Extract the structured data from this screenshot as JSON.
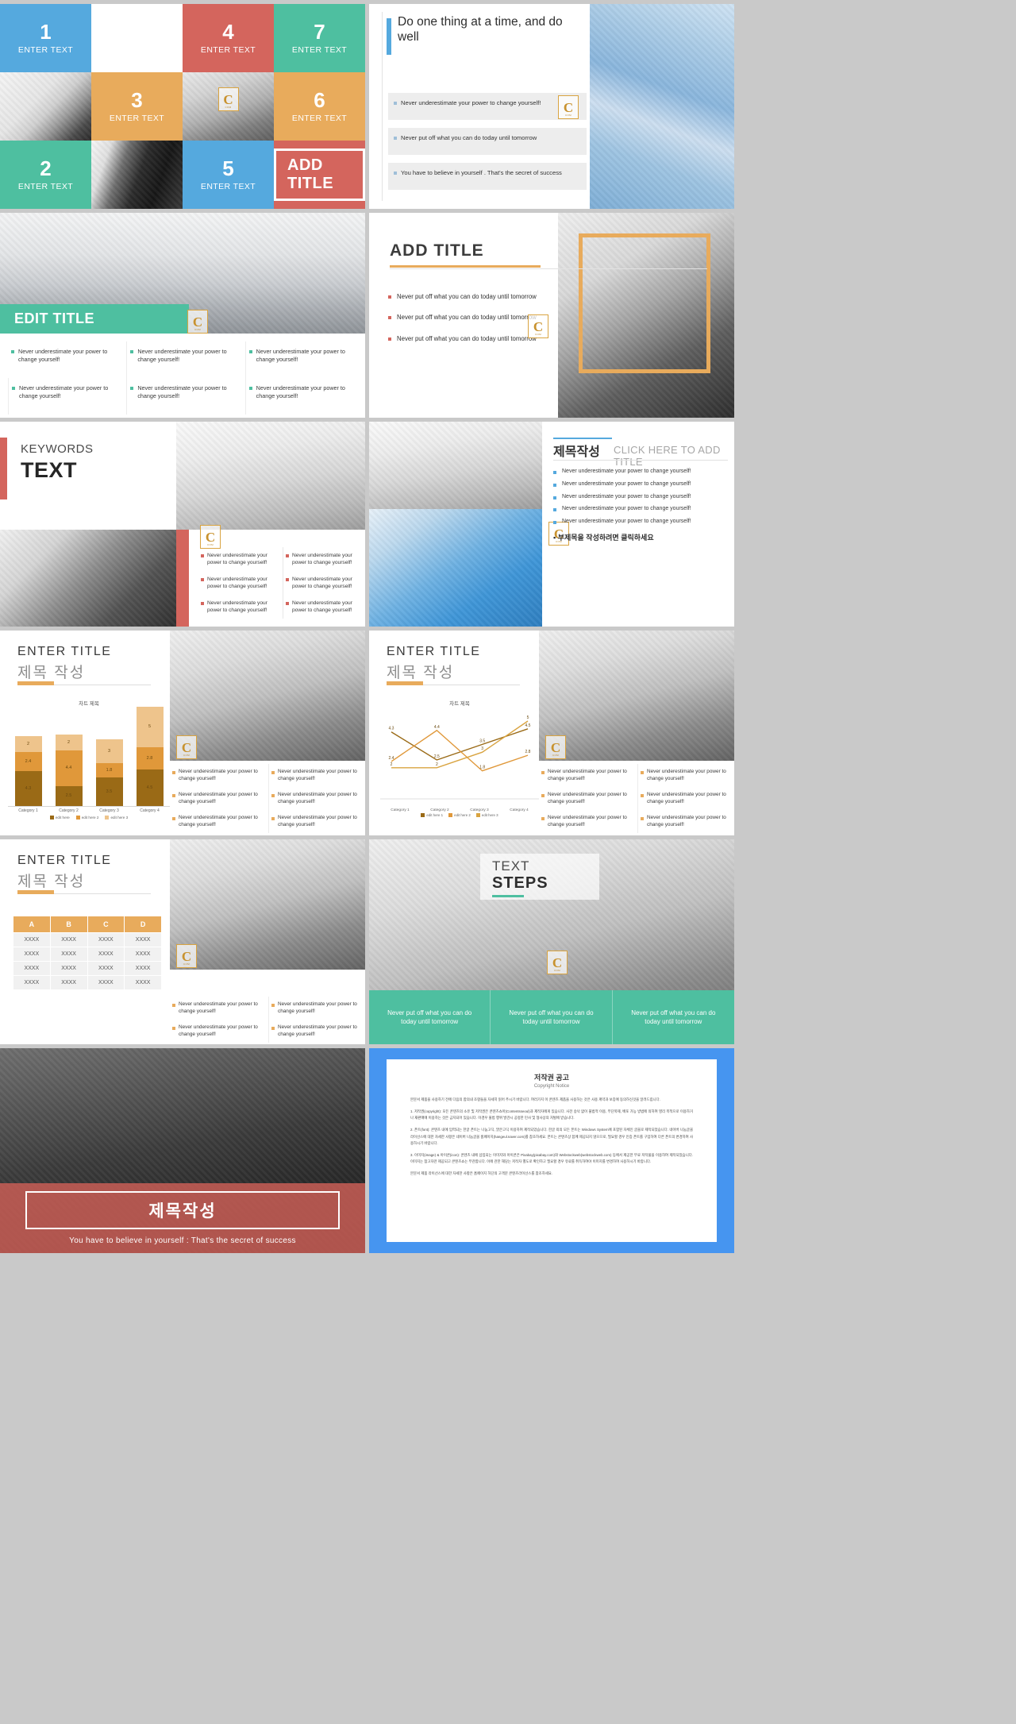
{
  "brand": {
    "logo_letter": "C",
    "logo_sub": "COM",
    "colors": {
      "blue": "#55a9de",
      "red": "#d4655d",
      "teal": "#4ebfa0",
      "orange": "#e8ab5c",
      "gold": "#9a6a16",
      "page_bg": "#c9c9c9"
    }
  },
  "slide1": {
    "tiles": [
      {
        "num": "1",
        "caption": "ENTER TEXT",
        "kind": "color",
        "color": "blue"
      },
      {
        "num": "",
        "caption": "",
        "kind": "blank",
        "color": "white"
      },
      {
        "num": "4",
        "caption": "ENTER TEXT",
        "kind": "color",
        "color": "red"
      },
      {
        "num": "",
        "caption": "",
        "kind": "photo",
        "photo": "ph-suit"
      },
      {
        "num": "7",
        "caption": "ENTER TEXT",
        "kind": "color",
        "color": "teal"
      },
      {
        "num": "",
        "caption": "",
        "kind": "photo",
        "photo": "ph-calc"
      },
      {
        "num": "3",
        "caption": "ENTER TEXT",
        "kind": "color",
        "color": "orange"
      },
      {
        "num": "",
        "caption": "",
        "kind": "photo",
        "photo": "ph-meet"
      },
      {
        "num": "6",
        "caption": "ENTER TEXT",
        "kind": "color",
        "color": "orange"
      },
      {
        "num": "",
        "caption": "",
        "kind": "blank",
        "color": "white"
      },
      {
        "num": "2",
        "caption": "ENTER TEXT",
        "kind": "color",
        "color": "teal"
      },
      {
        "num": "",
        "caption": "",
        "kind": "photo",
        "photo": "ph-shake"
      },
      {
        "num": "5",
        "caption": "ENTER TEXT",
        "kind": "color",
        "color": "blue"
      },
      {
        "num": "",
        "caption": "ADD TITLE",
        "kind": "addtitle",
        "color": "red"
      }
    ],
    "add_title_label": "ADD TITLE"
  },
  "slide2": {
    "heading": "Do one thing at a time, and do well",
    "bullets": [
      "Never underestimate your power to change yourself!",
      "Never put off what you can do today until tomorrow",
      "You have to believe in yourself . That's the secret of success"
    ]
  },
  "slide3": {
    "title": "EDIT TITLE",
    "cells": [
      "Never underestimate your power to change yourself!",
      "Never underestimate your power to change yourself!",
      "Never underestimate your power to change yourself!",
      "Never underestimate your power to change yourself!",
      "Never underestimate your power to change yourself!",
      "Never underestimate your power to change yourself!"
    ]
  },
  "slide4": {
    "title": "ADD TITLE",
    "bullets": [
      "Never put off what you can do today until tomorrow",
      "Never put off what you can do today until tomorrow",
      "Never put off what you can do today until tomorrow"
    ]
  },
  "slide5": {
    "keywords_label": "KEYWORDS",
    "text_label": "TEXT",
    "cells": [
      "Never underestimate your power to change yourself!",
      "Never underestimate your power to change yourself!",
      "Never underestimate your power to change yourself!",
      "Never underestimate your power to change yourself!",
      "Never underestimate your power to change yourself!",
      "Never underestimate your power to change yourself!"
    ]
  },
  "slide6": {
    "title": "제목작성",
    "subtitle": "CLICK HERE TO ADD TITLE",
    "bullets": [
      "Never underestimate your power to change yourself!",
      "Never underestimate your power to change yourself!",
      "Never underestimate your power to change yourself!",
      "Never underestimate your power to change yourself!",
      "Never underestimate your power to change yourself!"
    ],
    "footer": "▪ 부제목을 작성하려면 클릭하세요"
  },
  "slide7": {
    "title_en": "ENTER TITLE",
    "title_kr": "제목 작성",
    "cells": [
      "Never underestimate your power to change yourself!",
      "Never underestimate your power to change yourself!",
      "Never underestimate your power to change yourself!",
      "Never underestimate your power to change yourself!",
      "Never underestimate your power to change yourself!",
      "Never underestimate your power to change yourself!"
    ]
  },
  "slide8": {
    "title_en": "ENTER TITLE",
    "title_kr": "제목 작성",
    "cells": [
      "Never underestimate your power to change yourself!",
      "Never underestimate your power to change yourself!",
      "Never underestimate your power to change yourself!",
      "Never underestimate your power to change yourself!",
      "Never underestimate your power to change yourself!",
      "Never underestimate your power to change yourself!"
    ]
  },
  "slide9": {
    "title_en": "ENTER TITLE",
    "title_kr": "제목 작성",
    "table": {
      "headers": [
        "A",
        "B",
        "C",
        "D"
      ],
      "rows": [
        [
          "XXXX",
          "XXXX",
          "XXXX",
          "XXXX"
        ],
        [
          "XXXX",
          "XXXX",
          "XXXX",
          "XXXX"
        ],
        [
          "XXXX",
          "XXXX",
          "XXXX",
          "XXXX"
        ],
        [
          "XXXX",
          "XXXX",
          "XXXX",
          "XXXX"
        ]
      ]
    },
    "cells": [
      "Never underestimate your power to change yourself!",
      "Never underestimate your power to change yourself!",
      "Never underestimate your power to change yourself!",
      "Never underestimate your power to change yourself!"
    ]
  },
  "slide10": {
    "title_top": "TEXT",
    "title_bottom": "STEPS",
    "steps": [
      "Never put off what you can do today until tomorrow",
      "Never put off what you can do today until tomorrow",
      "Never put off what you can do today until tomorrow"
    ]
  },
  "slide11": {
    "title": "제목작성",
    "subtitle": "You have to believe in yourself : That's the secret of success"
  },
  "slide12": {
    "heading": "저작권 공고",
    "subheading": "Copyright Notice",
    "intro": "본문서 제품을 사용하기 전에 다음의 합의내 조항들을 자세히 읽어 주시기 바랍니다. 여러가지 이 콘텐츠 제품을 사용하는 것은 사용 계약과 보증에 동의하신것을 알려드립니다.",
    "para1": "1. 저작권(copyright): 모든 콘텐츠의 소유 및 저작권은 콘텐츠쇼아(Contentsseoul)과 제작자에게 있습니다. 사전 승낙 없이 불법적 이용, 무단복제, 배포 가능 방법에 의하여 영리 목적으로 이용하거나 재판매에 이용하는 것은 금지되어 있습니다. 이경우 불법 행위 발견시 공정한 민사 및 형사상의 처벌에 받습니다.",
    "para2": "2. 폰트(font): 콘텐츠 내에 입력되는 한글 폰트는 나눔고딕, 맑은고딕 이용하여 제작되었습니다. 한글 외의 모든 폰트는 Windows System에 포함된 자체인 글꼴로 제작되었습니다. 네이버 나눔글꼴 라이선스에 대한 자세한 사항은 네이버 나눔글꼴 홈페이지(hangeul.naver.com)를 참조하세요. 폰트는 콘텐츠상 함께 제공되지 않으므로, 필요할 경우 인증 폰트를 구입하여 다른 폰트의 변경하여 사용하시기 바랍니다.",
    "para3": "3. 이미지(image) & 아이콘(icon): 콘텐츠 내에 삽입되는 이미지와 아이콘은 Pixabay(pixabay.com)와 Webstockweb(webstockweb.com) 등에서 제공한 무료 저작물을 이용하여 제작되었습니다. 이미지는 참고자만 제공되고 콘텐츠쇼는 무관합니다. 이에 관한 해당는 저작자 별도로 확인하고 필요할 경우 유료를 취득하여야 이미지를 변경하여 사용하시기 바랍니다.",
    "outro": "본문서 제품 라이선스에 대한 자세한 사항은 홈페이지 하단의 고객문 콘텐츠라이선스를 참조하세요."
  },
  "chart_data": [
    {
      "type": "bar",
      "subtype": "stacked",
      "title": "차트 제목",
      "categories": [
        "Category 1",
        "Category 2",
        "Category 3",
        "Category 4"
      ],
      "series": [
        {
          "name": "edit here",
          "color": "#9a6a16",
          "values": [
            4.3,
            2.5,
            3.5,
            4.5
          ]
        },
        {
          "name": "edit here 2",
          "color": "#e0983a",
          "values": [
            2.4,
            4.4,
            1.8,
            2.8
          ]
        },
        {
          "name": "edit here 3",
          "color": "#eec48c",
          "values": [
            2,
            2,
            3,
            5
          ]
        }
      ],
      "ylim": [
        0,
        12
      ],
      "grid": false,
      "legend": "bottom"
    },
    {
      "type": "line",
      "title": "차트 제목",
      "categories": [
        "Category 1",
        "Category 2",
        "Category 3",
        "Category 4"
      ],
      "series": [
        {
          "name": "edit here 1",
          "color": "#9a6a16",
          "values": [
            4.3,
            2.5,
            3.5,
            4.5
          ]
        },
        {
          "name": "edit here 2",
          "color": "#e0983a",
          "values": [
            2.4,
            4.4,
            1.8,
            2.8
          ]
        },
        {
          "name": "edit here 3",
          "color": "#d9a441",
          "values": [
            2,
            2,
            3,
            5
          ]
        }
      ],
      "ylim": [
        0,
        5
      ],
      "grid": false,
      "legend": "bottom"
    }
  ]
}
